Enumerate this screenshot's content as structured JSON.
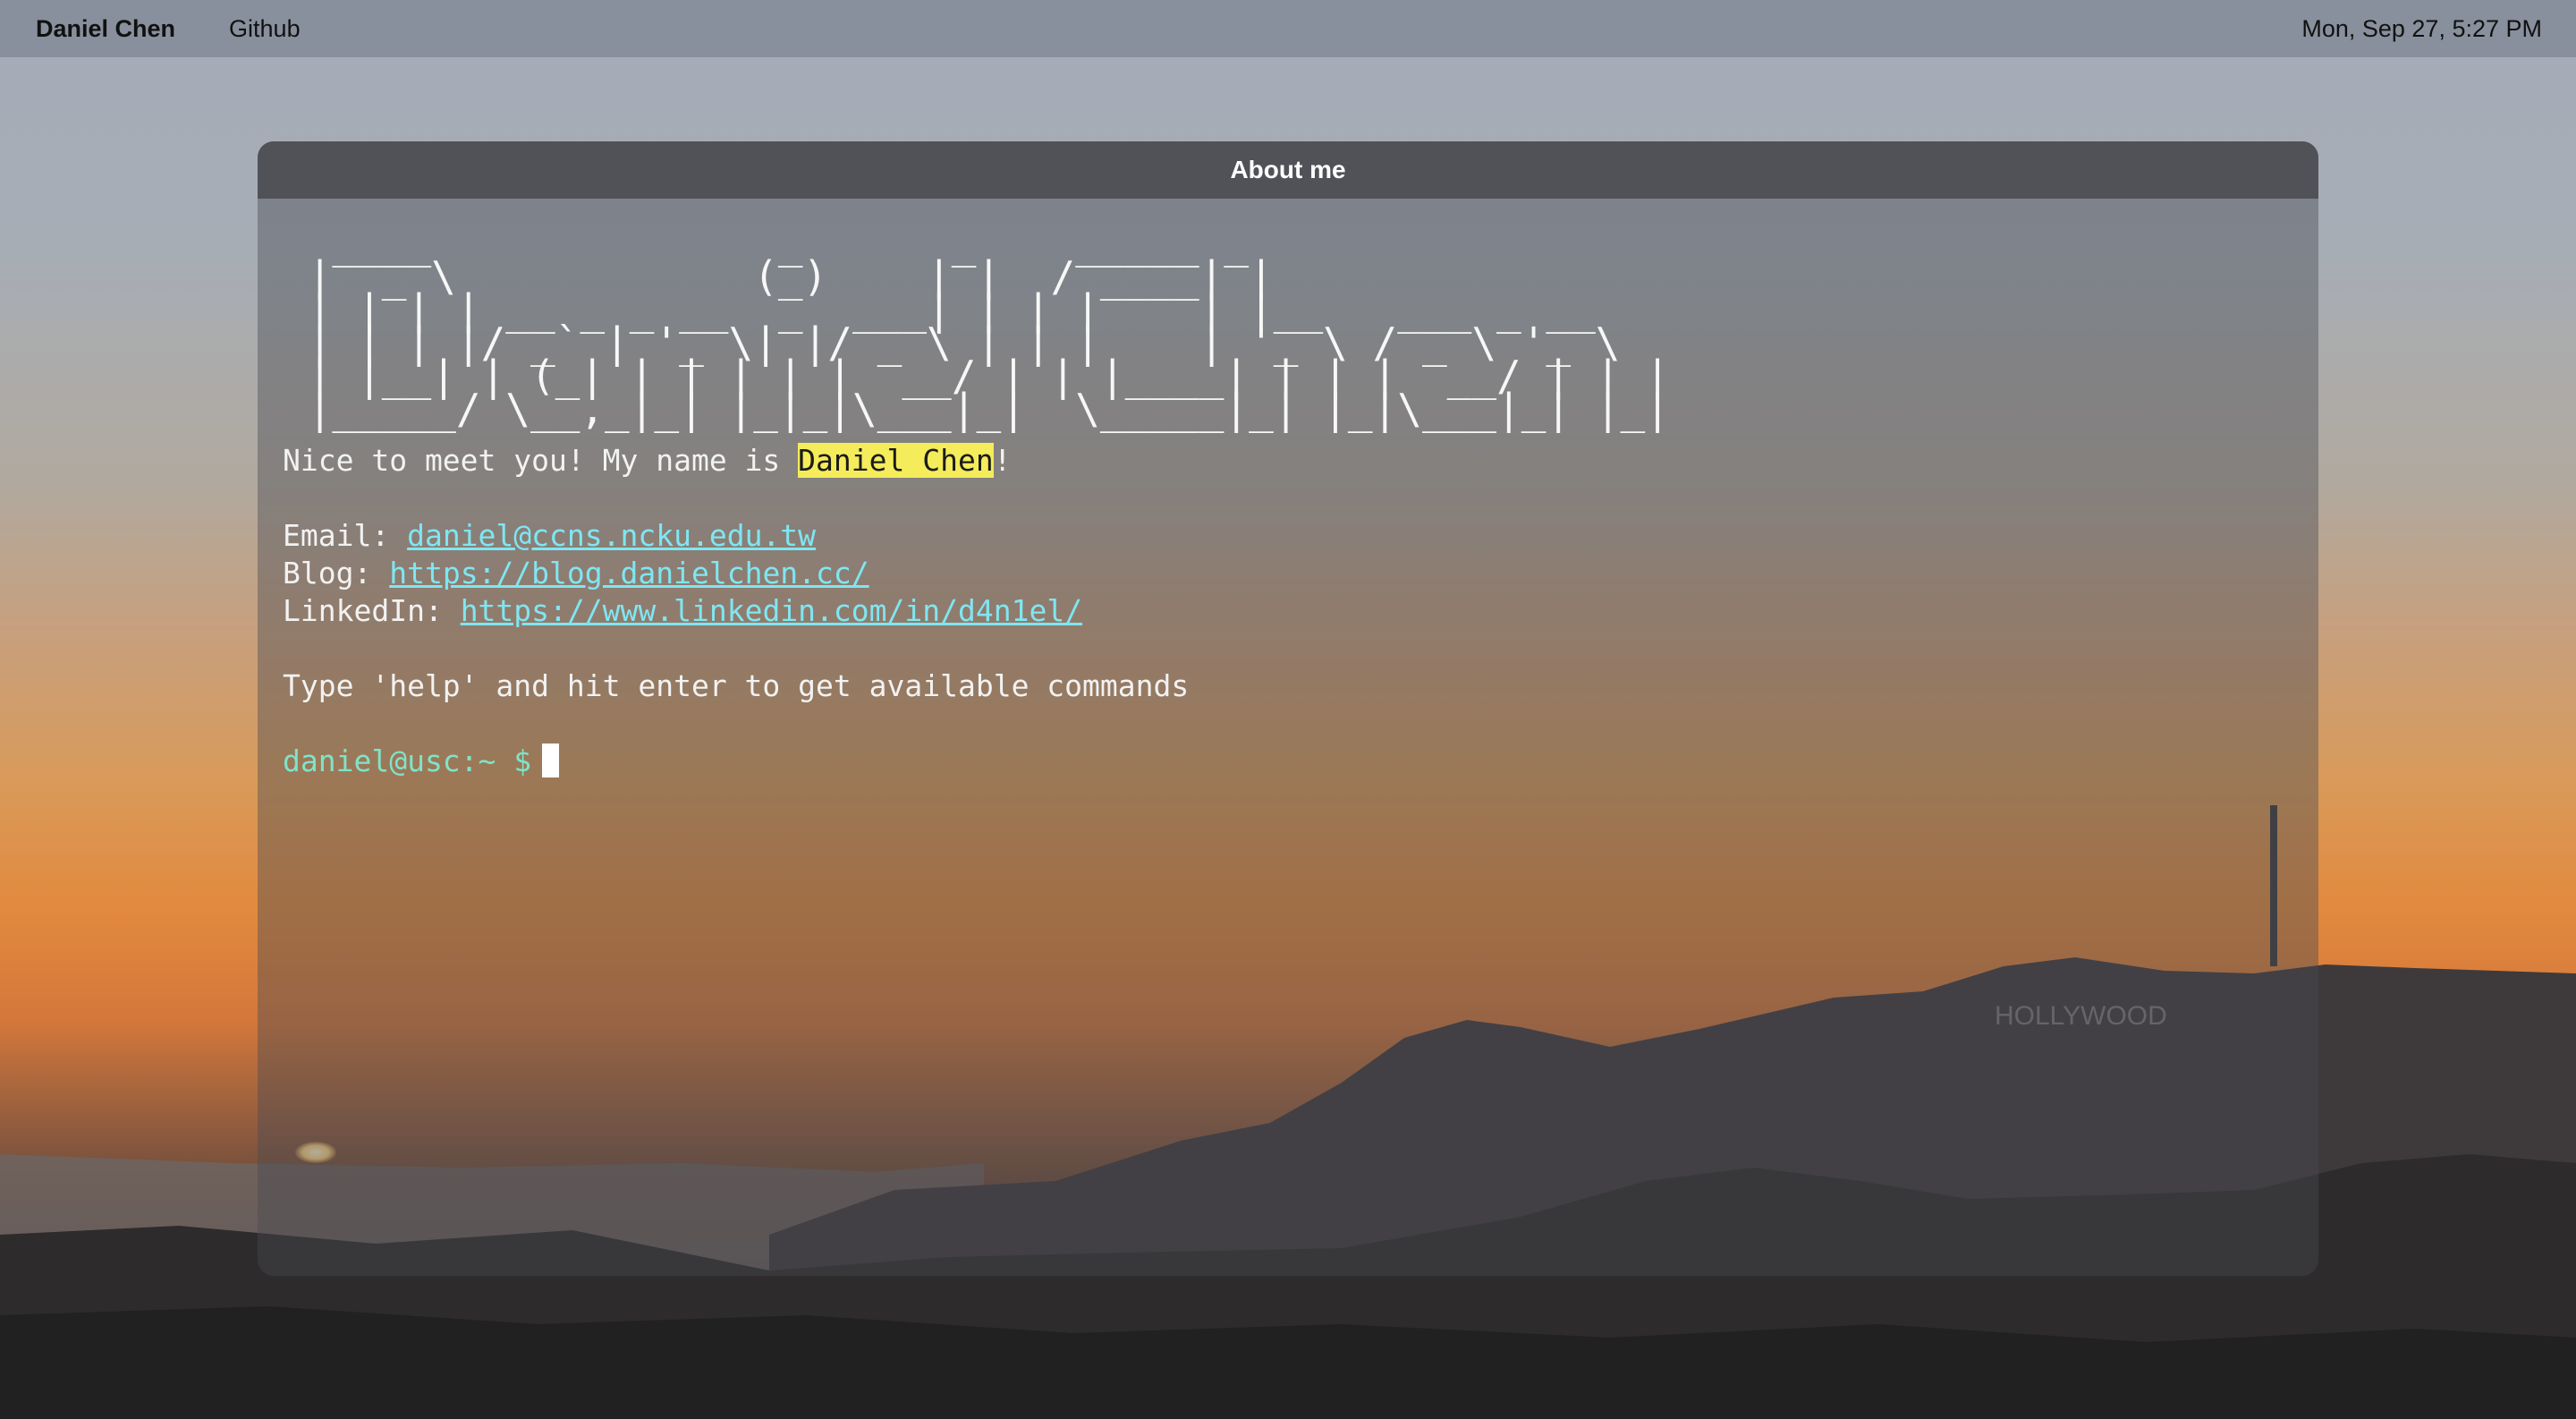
{
  "menubar": {
    "brand": "Daniel Chen",
    "github_label": "Github",
    "clock": "Mon, Sep 27, 5:27 PM"
  },
  "window": {
    "title": "About me"
  },
  "terminal": {
    "ascii_banner": "  ____              _      _    _____ _                \n |  _ \\            (_)    | |  / ____| |               \n | | | | __ _ _ __  _  ___| | | |    | |__   ___ _ __  \n | | | |/ _` | '_ \\| |/ _ \\ | | |    | '_ \\ / _ \\ '_ \\ \n | |__| | (_| | | | | |  __/ | | |____| | | |  __/ | | |\n |_____/ \\__,_|_| |_|_|\\___|_|  \\_____|_| |_|\\___|_| |_|",
    "intro_prefix": "Nice to meet you! My name is ",
    "intro_name": "Daniel Chen",
    "intro_suffix": "!",
    "email_label": "Email: ",
    "email_value": "daniel@ccns.ncku.edu.tw",
    "blog_label": "Blog: ",
    "blog_value": "https://blog.danielchen.cc/",
    "linkedin_label": "LinkedIn: ",
    "linkedin_value": "https://www.linkedin.com/in/d4n1el/",
    "help_text": "Type 'help' and hit enter to get available commands",
    "prompt": "daniel@usc:~",
    "prompt_symbol": " $"
  },
  "colors": {
    "highlight": "#f4ec5a",
    "link": "#7fe6f2",
    "prompt": "#7fe3c8"
  }
}
